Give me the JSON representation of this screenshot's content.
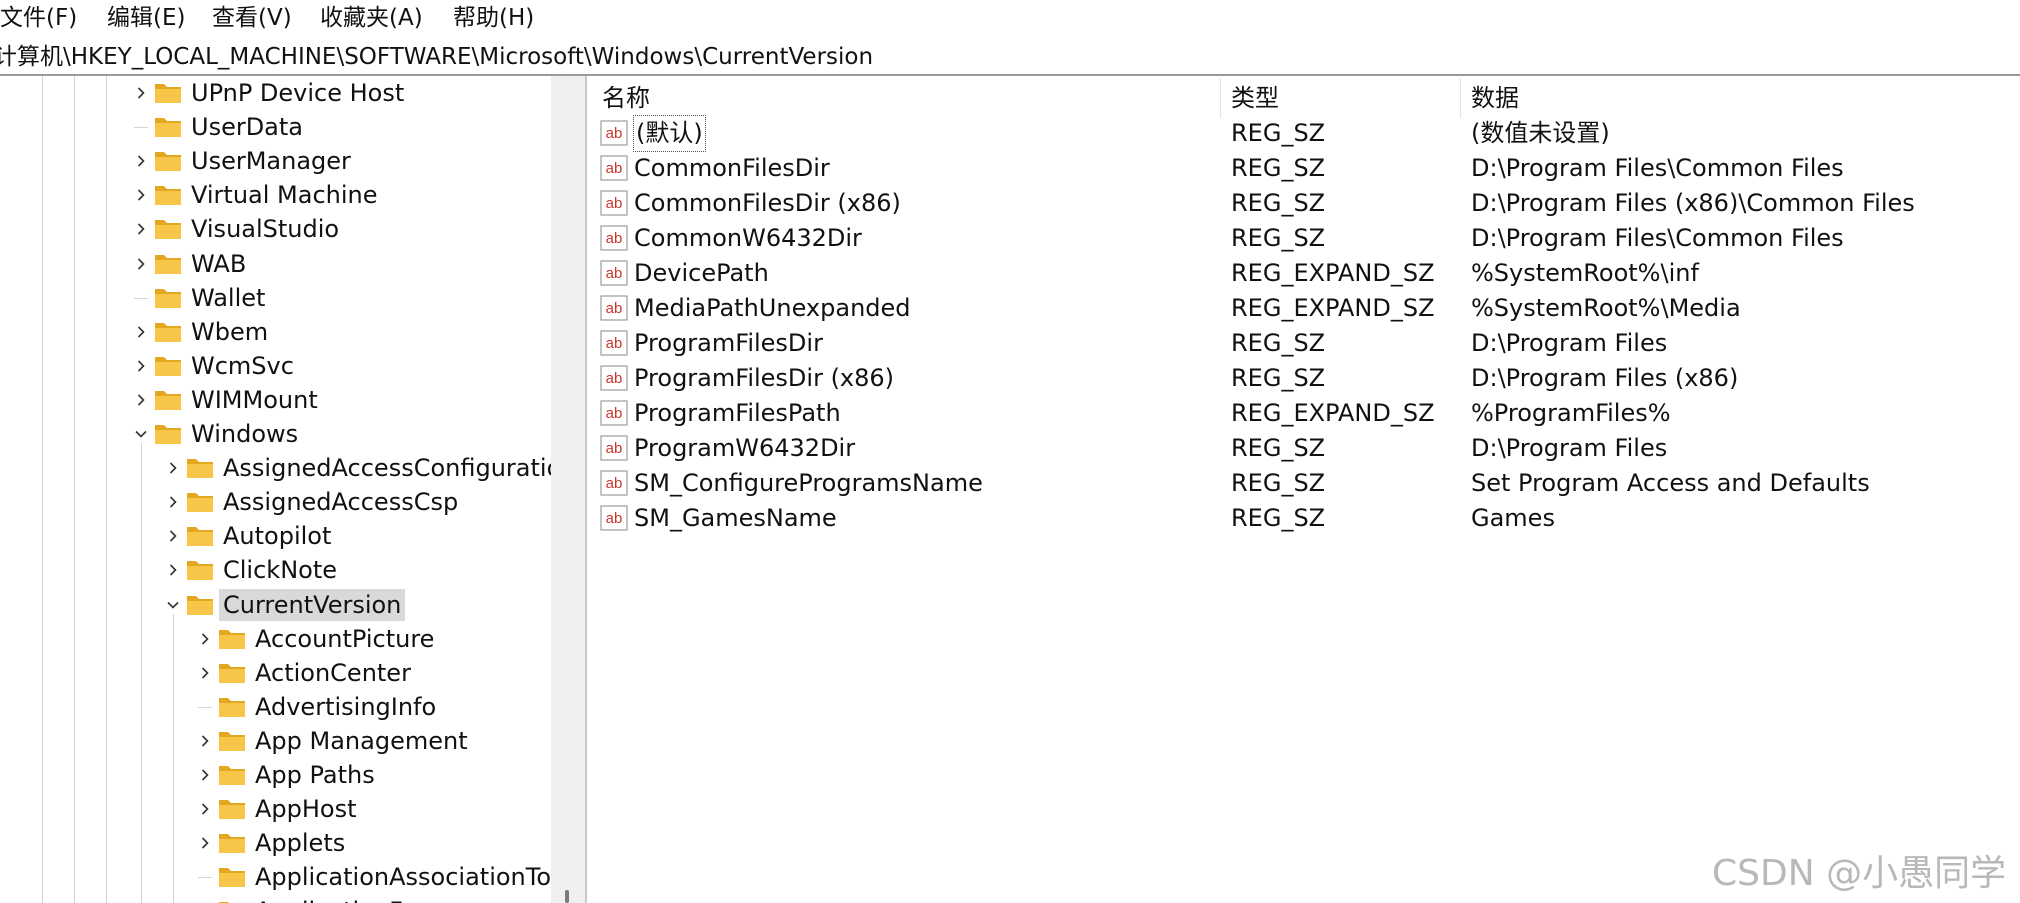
{
  "menu": [
    "文件(F)",
    "编辑(E)",
    "查看(V)",
    "收藏夹(A)",
    "帮助(H)"
  ],
  "address": "计算机\\HKEY_LOCAL_MACHINE\\SOFTWARE\\Microsoft\\Windows\\CurrentVersion",
  "tree": [
    {
      "label": "UPnP Device Host",
      "expander": "collapsed"
    },
    {
      "label": "UserData",
      "expander": "none"
    },
    {
      "label": "UserManager",
      "expander": "collapsed"
    },
    {
      "label": "Virtual Machine",
      "expander": "collapsed"
    },
    {
      "label": "VisualStudio",
      "expander": "collapsed"
    },
    {
      "label": "WAB",
      "expander": "collapsed"
    },
    {
      "label": "Wallet",
      "expander": "none"
    },
    {
      "label": "Wbem",
      "expander": "collapsed"
    },
    {
      "label": "WcmSvc",
      "expander": "collapsed"
    },
    {
      "label": "WIMMount",
      "expander": "collapsed"
    },
    {
      "label": "Windows",
      "expander": "expanded"
    },
    {
      "label": "AssignedAccessConfiguratior",
      "expander": "collapsed"
    },
    {
      "label": "AssignedAccessCsp",
      "expander": "collapsed"
    },
    {
      "label": "Autopilot",
      "expander": "collapsed"
    },
    {
      "label": "ClickNote",
      "expander": "collapsed"
    },
    {
      "label": "CurrentVersion",
      "expander": "expanded",
      "selected": true
    },
    {
      "label": "AccountPicture",
      "expander": "collapsed"
    },
    {
      "label": "ActionCenter",
      "expander": "collapsed"
    },
    {
      "label": "AdvertisingInfo",
      "expander": "none"
    },
    {
      "label": "App Management",
      "expander": "collapsed"
    },
    {
      "label": "App Paths",
      "expander": "collapsed"
    },
    {
      "label": "AppHost",
      "expander": "collapsed"
    },
    {
      "label": "Applets",
      "expander": "collapsed"
    },
    {
      "label": "ApplicationAssociationToa",
      "expander": "none"
    },
    {
      "label": "ApplicationF",
      "expander": "collapsed"
    }
  ],
  "columns": {
    "name": "名称",
    "type": "类型",
    "data": "数据"
  },
  "values": [
    {
      "name": "(默认)",
      "type": "REG_SZ",
      "data": "(数值未设置)",
      "focused": true
    },
    {
      "name": "CommonFilesDir",
      "type": "REG_SZ",
      "data": "D:\\Program Files\\Common Files"
    },
    {
      "name": "CommonFilesDir (x86)",
      "type": "REG_SZ",
      "data": "D:\\Program Files (x86)\\Common Files"
    },
    {
      "name": "CommonW6432Dir",
      "type": "REG_SZ",
      "data": "D:\\Program Files\\Common Files"
    },
    {
      "name": "DevicePath",
      "type": "REG_EXPAND_SZ",
      "data": "%SystemRoot%\\inf"
    },
    {
      "name": "MediaPathUnexpanded",
      "type": "REG_EXPAND_SZ",
      "data": "%SystemRoot%\\Media"
    },
    {
      "name": "ProgramFilesDir",
      "type": "REG_SZ",
      "data": "D:\\Program Files"
    },
    {
      "name": "ProgramFilesDir (x86)",
      "type": "REG_SZ",
      "data": "D:\\Program Files (x86)"
    },
    {
      "name": "ProgramFilesPath",
      "type": "REG_EXPAND_SZ",
      "data": "%ProgramFiles%"
    },
    {
      "name": "ProgramW6432Dir",
      "type": "REG_SZ",
      "data": "D:\\Program Files"
    },
    {
      "name": "SM_ConfigureProgramsName",
      "type": "REG_SZ",
      "data": "Set Program Access and Defaults"
    },
    {
      "name": "SM_GamesName",
      "type": "REG_SZ",
      "data": "Games"
    }
  ],
  "value_icon_text": "ab",
  "watermark": "CSDN @小愚同学",
  "colors": {
    "folder": "#f7c548",
    "folder_dark": "#e3a81f",
    "value_icon": "#c8372d",
    "selected": "#d9d9d9"
  }
}
